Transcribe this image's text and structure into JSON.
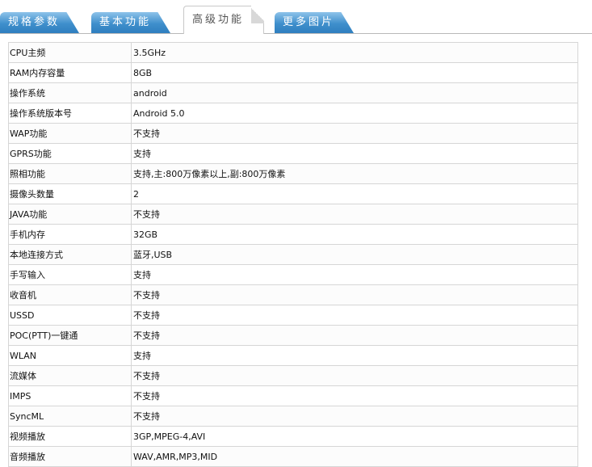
{
  "tabs": [
    {
      "label": "规格参数"
    },
    {
      "label": "基本功能"
    },
    {
      "label": "高级功能",
      "active": true
    },
    {
      "label": "更多图片"
    }
  ],
  "rows": [
    {
      "k": "CPU主频",
      "v": "3.5GHz"
    },
    {
      "k": "RAM内存容量",
      "v": "8GB"
    },
    {
      "k": "操作系统",
      "v": "android"
    },
    {
      "k": "操作系统版本号",
      "v": "Android 5.0"
    },
    {
      "k": "WAP功能",
      "v": "不支持"
    },
    {
      "k": "GPRS功能",
      "v": "支持"
    },
    {
      "k": "照相功能",
      "v": "支持,主:800万像素以上,副:800万像素"
    },
    {
      "k": "摄像头数量",
      "v": "2"
    },
    {
      "k": "JAVA功能",
      "v": "不支持"
    },
    {
      "k": "手机内存",
      "v": "32GB"
    },
    {
      "k": "本地连接方式",
      "v": "蓝牙,USB"
    },
    {
      "k": "手写输入",
      "v": "支持"
    },
    {
      "k": "收音机",
      "v": "不支持"
    },
    {
      "k": "USSD",
      "v": "不支持"
    },
    {
      "k": "POC(PTT)一键通",
      "v": "不支持"
    },
    {
      "k": "WLAN",
      "v": "支持"
    },
    {
      "k": "流媒体",
      "v": "不支持"
    },
    {
      "k": "IMPS",
      "v": "不支持"
    },
    {
      "k": "SyncML",
      "v": "不支持"
    },
    {
      "k": "视频播放",
      "v": "3GP,MPEG-4,AVI"
    },
    {
      "k": "音频播放",
      "v": "WAV,AMR,MP3,MID"
    }
  ]
}
